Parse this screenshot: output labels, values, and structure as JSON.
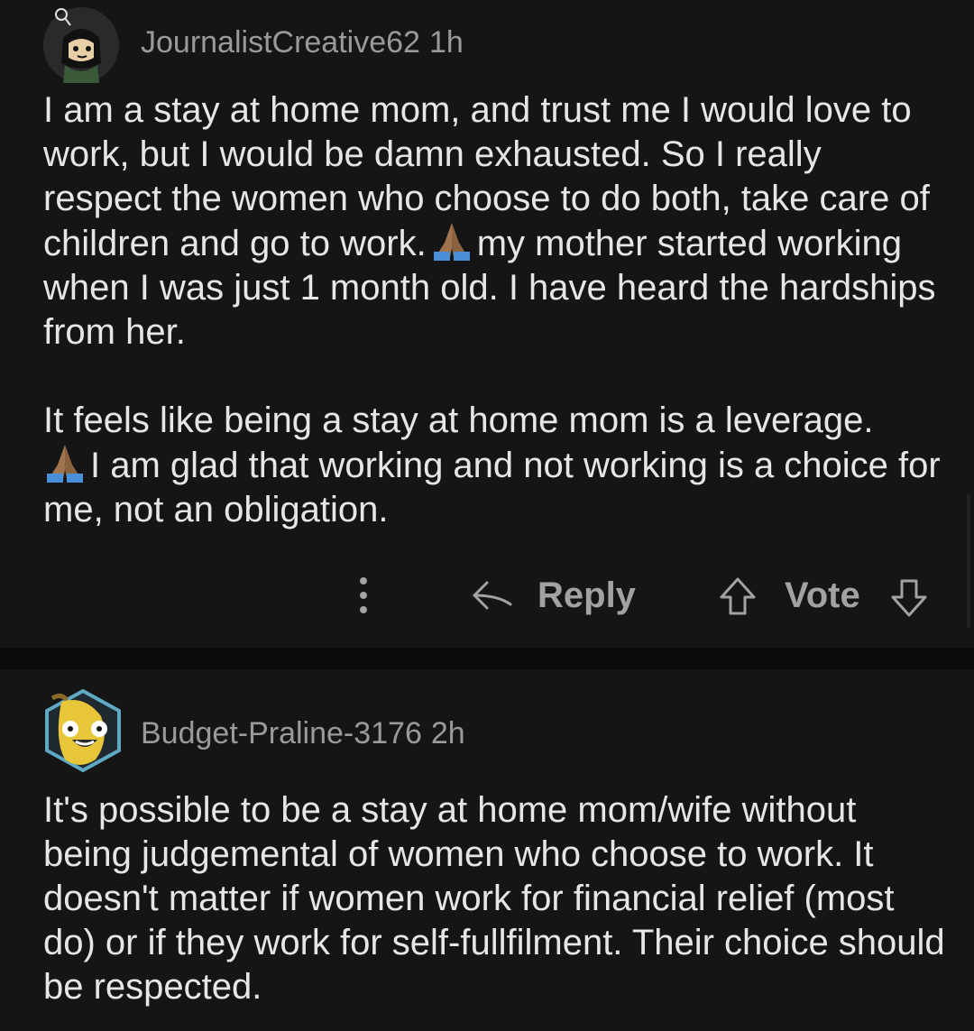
{
  "comments": [
    {
      "username": "JournalistCreative62",
      "time": "1h",
      "paragraph1_a": "I am a stay at home mom, and trust me I would love to work, but I would be damn exhausted. So I really respect the women who choose to do both, take care of children and go to work.",
      "paragraph1_b": "my mother started working when I was just 1 month old. I have heard the hardships from her.",
      "paragraph2_a": "It feels like being a stay at home mom is a leverage.",
      "paragraph2_b": "I am glad that working and not working is a choice for me, not an obligation.",
      "emoji": "folded-hands-emoji",
      "actions": {
        "reply_label": "Reply",
        "vote_label": "Vote"
      }
    },
    {
      "username": "Budget-Praline-3176",
      "time": "2h",
      "paragraph1": "It's possible to be a stay at home mom/wife without being judgemental of women who choose to work. It doesn't matter if women work for financial relief (most do) or if they work for self-fullfilment. Their choice should be respected."
    }
  ],
  "icons": {
    "more": "more-vertical-icon",
    "reply": "reply-arrow-icon",
    "upvote": "upvote-arrow-icon",
    "downvote": "downvote-arrow-icon"
  },
  "colors": {
    "background": "#0b0b0b",
    "card": "#151515",
    "text": "#e6e6e6",
    "muted": "#9a9a9a",
    "emoji_skin": "#a0744f",
    "emoji_sleeve": "#4a90d9"
  }
}
